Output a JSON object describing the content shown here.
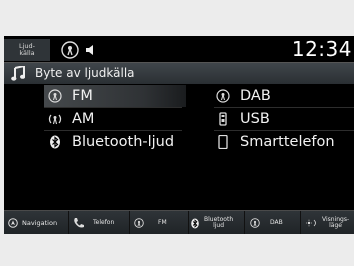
{
  "status": {
    "source_tab_label": "Ljud-\nkälla",
    "clock": "12:34"
  },
  "title": "Byte av ljudkälla",
  "sources": {
    "left": [
      {
        "label": "FM",
        "icon": "antenna-icon",
        "selected": true
      },
      {
        "label": "AM",
        "icon": "antenna-icon",
        "selected": false
      },
      {
        "label": "Bluetooth-ljud",
        "icon": "bluetooth-icon",
        "selected": false
      }
    ],
    "right": [
      {
        "label": "DAB",
        "icon": "antenna-icon",
        "selected": false
      },
      {
        "label": "USB",
        "icon": "usb-icon",
        "selected": false
      },
      {
        "label": "Smarttelefon",
        "icon": "phone-icon",
        "selected": false
      }
    ]
  },
  "nav": {
    "navigation": "Navigation",
    "telefon": "Telefon",
    "fm": "FM",
    "bluetooth": "Bluetooth\nljud",
    "dab": "DAB",
    "display_mode": "Visnings-\nläge"
  }
}
